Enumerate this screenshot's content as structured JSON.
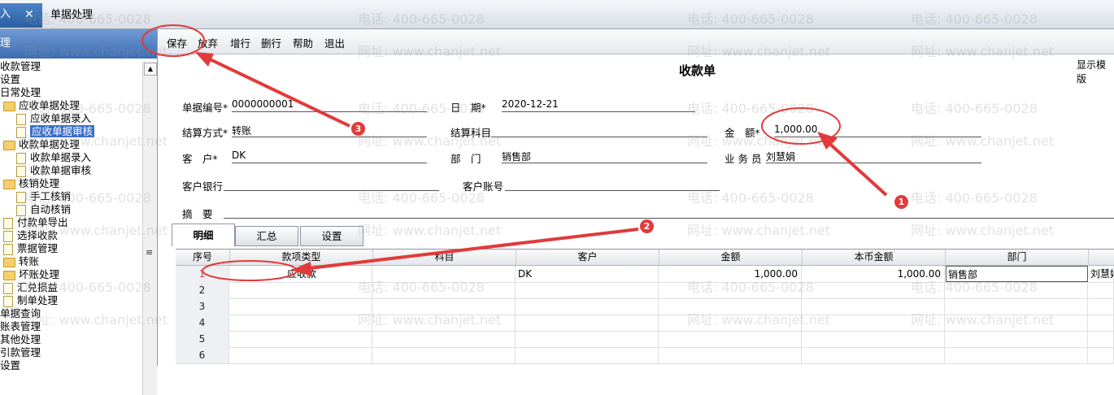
{
  "tabs": {
    "active_label": "入",
    "close_glyph": "✕",
    "second_label": "单据处理"
  },
  "left_panel": {
    "header": "理",
    "tree": [
      {
        "label": "收款管理",
        "x": 0,
        "icon": "none"
      },
      {
        "label": "设置",
        "x": 0,
        "icon": "none"
      },
      {
        "label": "日常处理",
        "x": 0,
        "icon": "none"
      },
      {
        "label": "应收单据处理",
        "x": 0,
        "icon": "folder"
      },
      {
        "label": "应收单据录入",
        "x": 16,
        "icon": "doc"
      },
      {
        "label": "应收单据审核",
        "x": 16,
        "icon": "doc",
        "selected": true
      },
      {
        "label": "收款单据处理",
        "x": 0,
        "icon": "folder"
      },
      {
        "label": "收款单据录入",
        "x": 16,
        "icon": "doc"
      },
      {
        "label": "收款单据审核",
        "x": 16,
        "icon": "doc"
      },
      {
        "label": "核销处理",
        "x": 0,
        "icon": "folder"
      },
      {
        "label": "手工核销",
        "x": 16,
        "icon": "doc"
      },
      {
        "label": "自动核销",
        "x": 16,
        "icon": "doc"
      },
      {
        "label": "付款单导出",
        "x": 0,
        "icon": "doc"
      },
      {
        "label": "选择收款",
        "x": 0,
        "icon": "doc"
      },
      {
        "label": "票据管理",
        "x": 0,
        "icon": "doc"
      },
      {
        "label": "转账",
        "x": 0,
        "icon": "folder"
      },
      {
        "label": "坏账处理",
        "x": 0,
        "icon": "folder"
      },
      {
        "label": "汇兑损益",
        "x": 0,
        "icon": "doc"
      },
      {
        "label": "制单处理",
        "x": 0,
        "icon": "doc"
      },
      {
        "label": "单据查询",
        "x": 0,
        "icon": "none"
      },
      {
        "label": "账表管理",
        "x": 0,
        "icon": "none"
      },
      {
        "label": "其他处理",
        "x": 0,
        "icon": "none"
      },
      {
        "label": "引款管理",
        "x": 0,
        "icon": "none"
      },
      {
        "label": "设置",
        "x": 0,
        "icon": "none"
      }
    ],
    "scroll_up_glyph": "▲",
    "grip_glyph": "≡"
  },
  "toolbar": {
    "save": "保存",
    "discard": "放弃",
    "add_row": "增行",
    "delete_row": "删行",
    "help": "帮助",
    "exit": "退出"
  },
  "form": {
    "title": "收款单",
    "template_link": "显示模版",
    "doc_no_label": "单据编号",
    "doc_no_value": "0000000001",
    "date_label": "日　期",
    "date_value": "2020-12-21",
    "settle_method_label": "结算方式",
    "settle_method_value": "转账",
    "settle_subject_label": "结算科目",
    "settle_subject_value": "",
    "amount_label": "金　额",
    "amount_value": "1,000.00",
    "customer_label": "客　户",
    "customer_value": "DK",
    "dept_label": "部　门",
    "dept_value": "销售部",
    "salesman_label": "业 务 员",
    "salesman_value": "刘慧娟",
    "customer_bank_label": "客户银行",
    "customer_bank_value": "",
    "customer_account_label": "客户账号",
    "customer_account_value": "",
    "summary_label": "摘　要",
    "summary_value": "",
    "required_mark": "*"
  },
  "detail_tabs": [
    "明细",
    "汇总",
    "设置"
  ],
  "grid": {
    "columns": [
      "序号",
      "款项类型",
      "科目",
      "客户",
      "金额",
      "本币金额",
      "部门"
    ],
    "rows": [
      {
        "no": "1",
        "type": "应收款",
        "subject": "",
        "customer": "DK",
        "amount": "1,000.00",
        "local_amount": "1,000.00",
        "dept": "销售部",
        "extra": "刘慧娟"
      },
      {
        "no": "2"
      },
      {
        "no": "3"
      },
      {
        "no": "4"
      },
      {
        "no": "5"
      },
      {
        "no": "6"
      }
    ]
  },
  "watermark": {
    "phone": "电话: 400-665-0028",
    "site": "网址: www.chanjet.net"
  },
  "annotations": {
    "markers": [
      "1",
      "2",
      "3"
    ],
    "color": "#e23a3a"
  }
}
